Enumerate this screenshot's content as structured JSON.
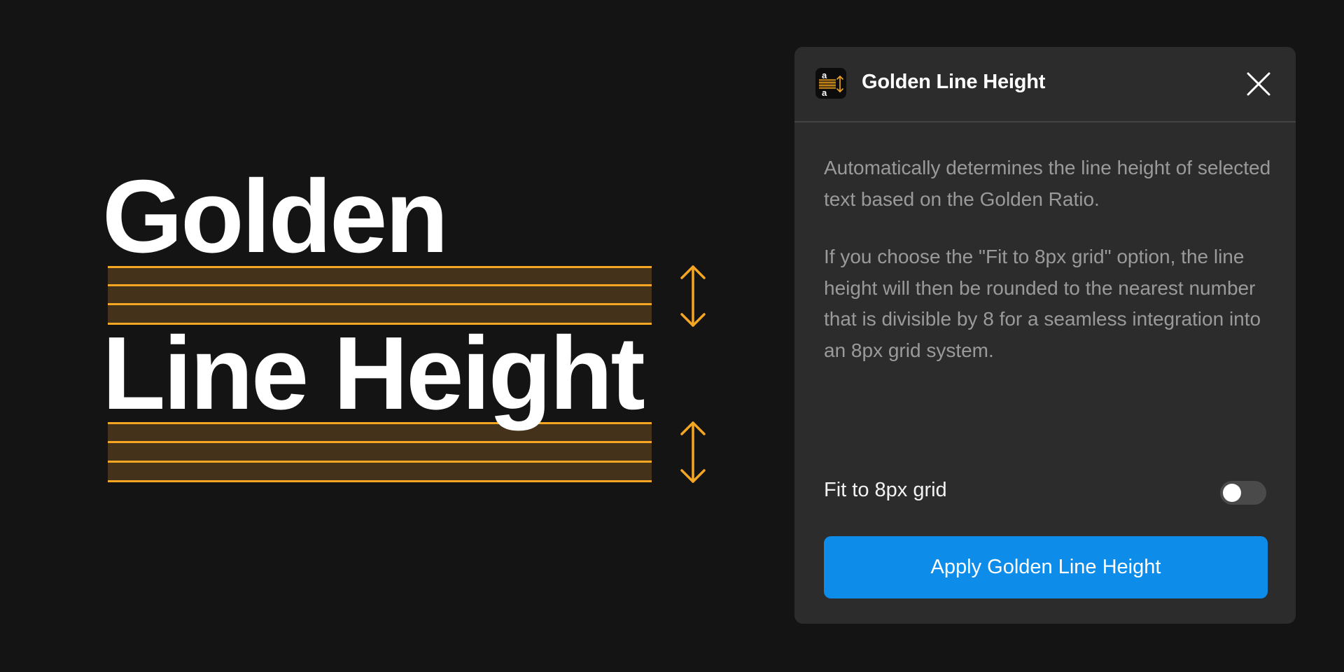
{
  "hero": {
    "word1": "Golden",
    "word2": "Line Height"
  },
  "panel": {
    "title": "Golden Line Height",
    "description_1": "Automatically determines the line height of selected text based on the Golden Ratio.",
    "description_2": "If you choose the \"Fit to 8px grid\" option, the line height will then be rounded to the nearest number that is divisible by 8 for a seamless integration into an 8px grid system.",
    "toggle": {
      "label": "Fit to 8px grid",
      "checked": false
    },
    "apply_label": "Apply Golden Line Height",
    "close_icon": "close-icon",
    "app_icon": "line-height-icon"
  },
  "colors": {
    "background": "#141414",
    "accent_orange": "#f5a623",
    "band_fill": "#45321a",
    "panel_bg": "#2c2c2c",
    "button_blue": "#0d8ce9",
    "muted_text": "#9a9a9a"
  }
}
